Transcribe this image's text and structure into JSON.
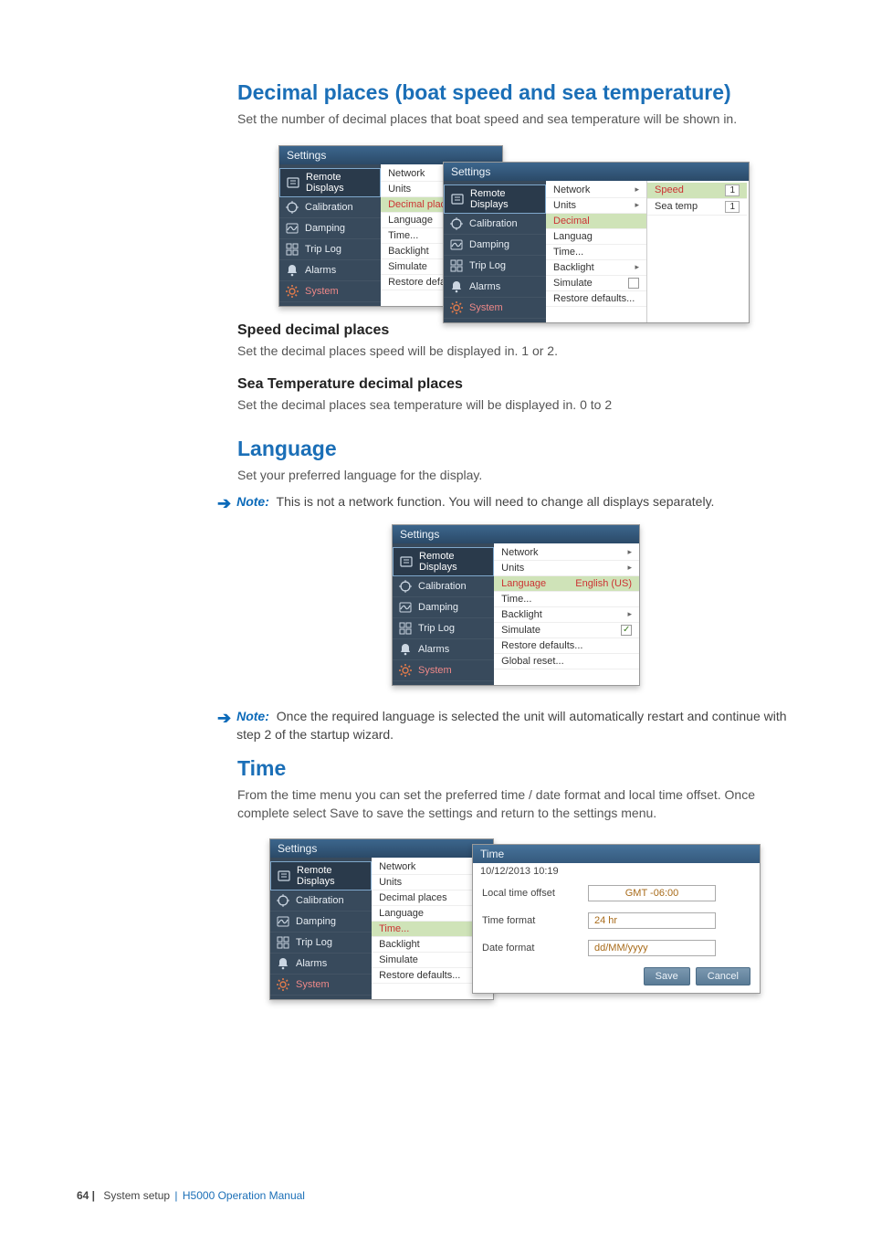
{
  "headings": {
    "decimal": "Decimal places (boat speed and sea temperature)",
    "decimal_intro": "Set the number of decimal places that boat speed and sea temperature will be shown in.",
    "speed_sub": "Speed decimal places",
    "speed_text": "Set the decimal places speed will be displayed in. 1 or 2.",
    "sea_sub": "Sea Temperature decimal places",
    "sea_text": "Set the decimal places sea temperature will be displayed in.  0 to 2",
    "language": "Language",
    "language_intro": "Set your preferred language for the display.",
    "note1": " This is not a network function. You will need to change all displays separately.",
    "note_label": "Note:",
    "note2": " Once the required language is selected the unit will automatically restart and continue with step 2 of the startup wizard.",
    "time": "Time",
    "time_intro": "From the time menu you can set the preferred time / date format and local time offset. Once complete select Save to save the settings and return to the settings menu."
  },
  "footer": {
    "page": "64 |",
    "sys": "System setup",
    "sep": " | ",
    "man": "H5000 Operation Manual"
  },
  "common": {
    "settings_title": "Settings",
    "side_items": [
      "Remote Displays",
      "Calibration",
      "Damping",
      "Trip Log",
      "Alarms",
      "System"
    ],
    "list_main": [
      "Network",
      "Units",
      "Decimal places",
      "Language",
      "Time...",
      "Backlight",
      "Simulate",
      "Restore defaults..."
    ],
    "list_main_ext": [
      "Network",
      "Units",
      "Decimal places",
      "Language",
      "Time...",
      "Backlight",
      "Simulate",
      "Restore defaults...",
      "Global reset..."
    ]
  },
  "decimal_popup": {
    "rows": [
      {
        "k": "Network",
        "type": "arrow"
      },
      {
        "k": "Units",
        "type": "arrow"
      },
      {
        "k": "Decimal",
        "type": "hi",
        "fly": [
          {
            "k": "Speed",
            "v": "1"
          },
          {
            "k": "Sea temp",
            "v": "1"
          }
        ]
      },
      {
        "k": "Languag",
        "type": "plain"
      },
      {
        "k": "Time...",
        "type": "plain"
      },
      {
        "k": "Backlight",
        "type": "arrow"
      },
      {
        "k": "Simulate",
        "type": "check"
      },
      {
        "k": "Restore defaults...",
        "type": "plain"
      }
    ]
  },
  "lang_popup": {
    "rows": [
      {
        "k": "Network",
        "type": "arrow"
      },
      {
        "k": "Units",
        "type": "arrow"
      },
      {
        "k": "Language",
        "v": "English (US)",
        "type": "hi"
      },
      {
        "k": "Time...",
        "type": "plain"
      },
      {
        "k": "Backlight",
        "type": "arrow"
      },
      {
        "k": "Simulate",
        "type": "check-on"
      },
      {
        "k": "Restore defaults...",
        "type": "plain"
      },
      {
        "k": "Global reset...",
        "type": "plain"
      }
    ]
  },
  "time_panel": {
    "time_title": "Time",
    "clock": "10/12/2013 10:19",
    "rows": [
      {
        "lbl": "Local time offset",
        "val": "GMT -06:00",
        "center": true
      },
      {
        "lbl": "Time format",
        "val": "24 hr"
      },
      {
        "lbl": "Date format",
        "val": "dd/MM/yyyy"
      }
    ],
    "btn_save": "Save",
    "btn_cancel": "Cancel"
  }
}
